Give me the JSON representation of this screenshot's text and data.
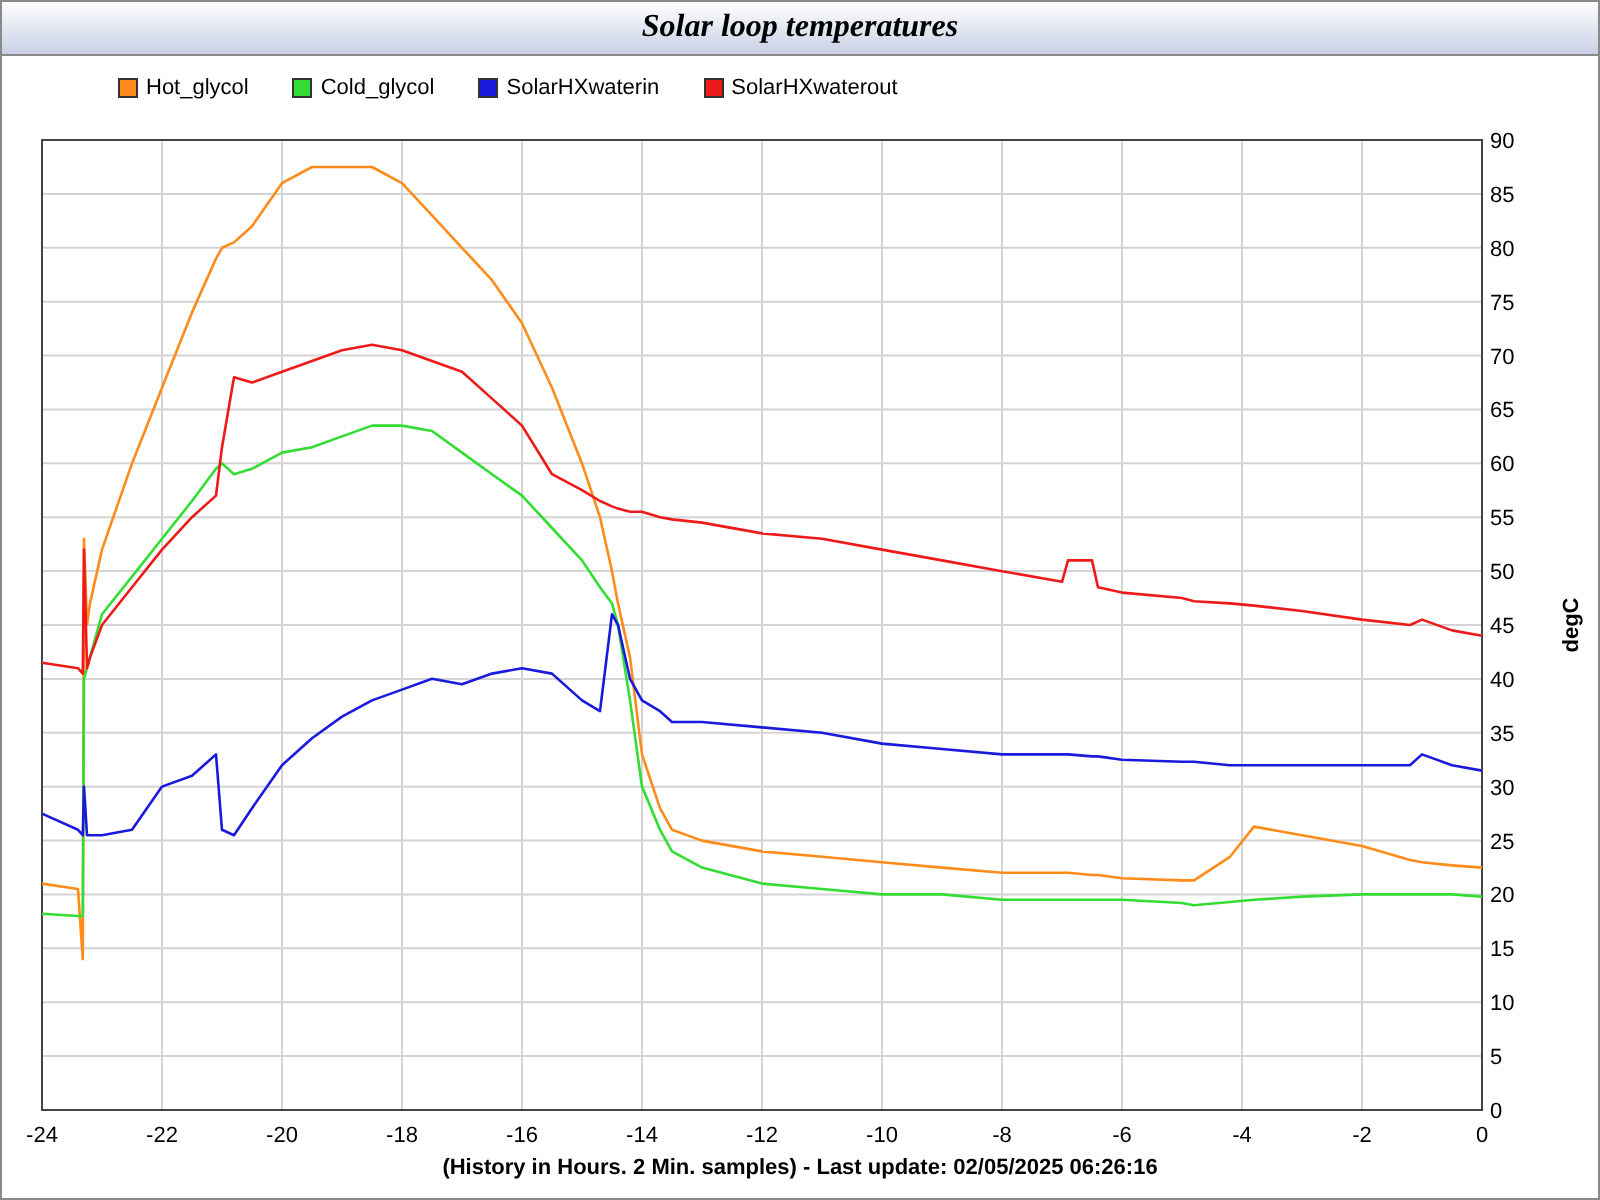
{
  "chart_data": {
    "type": "line",
    "title": "Solar loop temperatures",
    "xlabel": "(History in Hours. 2 Min. samples) - Last update: 02/05/2025 06:26:16",
    "ylabel": "degC",
    "x": [
      -24,
      -23.4,
      -23.32,
      -23.3,
      -23.25,
      -23.2,
      -23,
      -22.5,
      -22,
      -21.5,
      -21.1,
      -21,
      -20.8,
      -20.5,
      -20,
      -19.5,
      -19,
      -18.5,
      -18,
      -17.5,
      -17,
      -16.5,
      -16,
      -15.5,
      -15,
      -14.7,
      -14.5,
      -14.4,
      -14.2,
      -14,
      -13.7,
      -13.5,
      -13,
      -12,
      -11,
      -10,
      -9,
      -8,
      -7,
      -6.9,
      -6.5,
      -6.4,
      -6,
      -5,
      -4.8,
      -4.2,
      -3.8,
      -3,
      -2,
      -1.2,
      -1,
      -0.5,
      0
    ],
    "series": [
      {
        "name": "Hot_glycol",
        "color": "#ff8c1a",
        "values": [
          21,
          20.5,
          14,
          53,
          45,
          47,
          52,
          60,
          67,
          74,
          79,
          80,
          80.5,
          82,
          86,
          87.5,
          87.5,
          87.5,
          86,
          83,
          80,
          77,
          73,
          67,
          60,
          55,
          50,
          47,
          42,
          33,
          28,
          26,
          25,
          24,
          23.5,
          23,
          22.5,
          22,
          22,
          22,
          21.8,
          21.8,
          21.5,
          21.3,
          21.3,
          23.5,
          26.3,
          25.5,
          24.5,
          23.2,
          23,
          22.7,
          22.5
        ]
      },
      {
        "name": "Cold_glycol",
        "color": "#33dd33",
        "values": [
          18.2,
          18,
          18,
          40,
          41,
          42,
          46,
          49.5,
          53,
          56.5,
          59.5,
          60,
          59,
          59.5,
          61,
          61.5,
          62.5,
          63.5,
          63.5,
          63,
          61,
          59,
          57,
          54,
          51,
          48.5,
          47,
          45,
          38,
          30,
          26,
          24,
          22.5,
          21,
          20.5,
          20,
          20,
          19.5,
          19.5,
          19.5,
          19.5,
          19.5,
          19.5,
          19.2,
          19,
          19.3,
          19.5,
          19.8,
          20,
          20,
          20,
          20,
          19.8
        ]
      },
      {
        "name": "SolarHXwaterin",
        "color": "#1a1add",
        "values": [
          27.5,
          26,
          25.5,
          30,
          25.5,
          25.5,
          25.5,
          26,
          30,
          31,
          33,
          26,
          25.5,
          28,
          32,
          34.5,
          36.5,
          38,
          39,
          40,
          39.5,
          40.5,
          41,
          40.5,
          38,
          37,
          46,
          45,
          40,
          38,
          37,
          36,
          36,
          35.5,
          35,
          34,
          33.5,
          33,
          33,
          33,
          32.8,
          32.8,
          32.5,
          32.3,
          32.3,
          32,
          32,
          32,
          32,
          32,
          33,
          32,
          31.5
        ]
      },
      {
        "name": "SolarHXwaterout",
        "color": "#ee1a1a",
        "values": [
          41.5,
          41,
          40.5,
          52,
          41,
          42,
          45,
          48.5,
          52,
          55,
          57,
          61.5,
          68,
          67.5,
          68.5,
          69.5,
          70.5,
          71,
          70.5,
          69.5,
          68.5,
          66,
          63.5,
          59,
          57.5,
          56.5,
          56,
          55.8,
          55.5,
          55.5,
          55,
          54.8,
          54.5,
          53.5,
          53,
          52,
          51,
          50,
          49,
          51,
          51,
          48.5,
          48,
          47.5,
          47.2,
          47,
          46.8,
          46.3,
          45.5,
          45,
          45.5,
          44.5,
          44
        ]
      }
    ],
    "grid": true,
    "xlim": [
      -24,
      0
    ],
    "ylim": [
      0,
      90
    ],
    "xticks": [
      -24,
      -22,
      -20,
      -18,
      -16,
      -14,
      -12,
      -10,
      -8,
      -6,
      -4,
      -2,
      0
    ],
    "yticks": [
      0,
      5,
      10,
      15,
      20,
      25,
      30,
      35,
      40,
      45,
      50,
      55,
      60,
      65,
      70,
      75,
      80,
      85,
      90
    ]
  }
}
